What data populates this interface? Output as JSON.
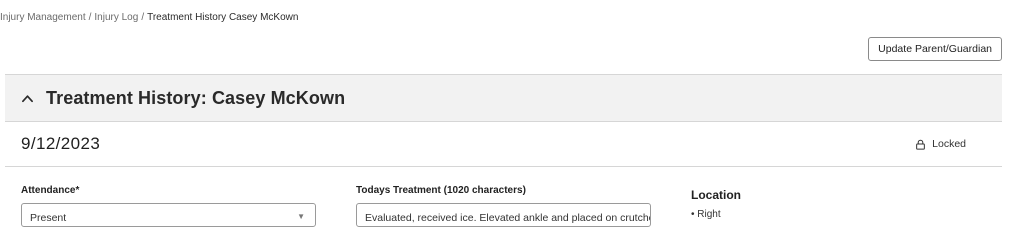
{
  "breadcrumb": {
    "items": [
      "Injury Management",
      "Injury Log"
    ],
    "separator": "/",
    "current": "Treatment History Casey McKown"
  },
  "actions": {
    "update_label": "Update Parent/Guardian"
  },
  "section": {
    "title": "Treatment History: Casey McKown",
    "expanded": true
  },
  "entry": {
    "date": "9/12/2023",
    "status_label": "Locked",
    "attendance": {
      "label": "Attendance*",
      "value": "Present"
    },
    "treatment": {
      "label": "Todays Treatment (1020 characters)",
      "value": "Evaluated, received ice. Elevated ankle and placed on crutches."
    },
    "location": {
      "label": "Location",
      "items": [
        "• Right"
      ]
    }
  },
  "colors": {
    "header_bg": "#f2f2f2",
    "border": "#d6d6d6",
    "text": "#1f1f1f"
  },
  "icons": {
    "collapse": "chevron-up-icon",
    "status": "lock-icon",
    "select": "chevron-down-icon"
  }
}
